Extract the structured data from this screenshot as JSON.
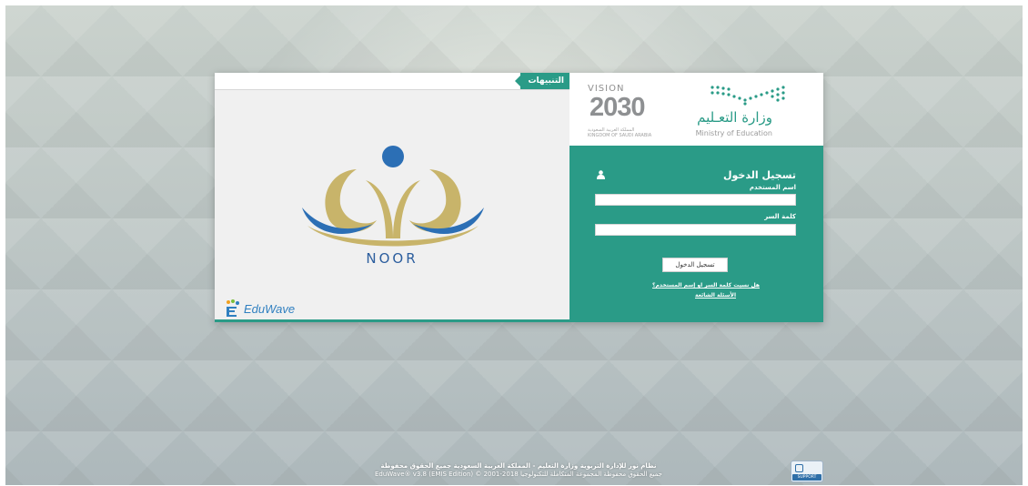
{
  "notifications": {
    "tab_label": "التنبيهات"
  },
  "noor": {
    "wordmark": "NOOR"
  },
  "eduwave": {
    "wordmark": "EduWave"
  },
  "vision": {
    "word": "VISION",
    "year": "2030",
    "subtitle_ar": "المملكة العربية السعودية",
    "subtitle_en": "KINGDOM OF SAUDI ARABIA"
  },
  "ministry": {
    "name_ar": "وزارة التعـليم",
    "name_en": "Ministry of Education"
  },
  "login": {
    "title": "تسجيل الدخول",
    "username_label": "اسم المستخدم",
    "username_value": "",
    "password_label": "كلمة السر",
    "password_value": "",
    "submit_label": "تسجيل الدخول",
    "forgot_link": "هل نسيت كلمة السر او إسم المستخدم؟",
    "faq_link": "الأسئلة الشائعة"
  },
  "footer": {
    "line1": "نظام نور للإدارة التربوية وزارة التعليم - المملكة العربية السعودية جميع الحقوق محفوظة",
    "line2": "EduWave® v3.8 (EMIS Edition) © 2001-2018 جميع الحقوق محفوظة المجموعة المتكاملة للتكنولوجيا",
    "support_label": "SUPPORT"
  },
  "colors": {
    "accent": "#2a9b87",
    "noor_blue": "#2c6fb5",
    "noor_gold": "#c8b46a"
  }
}
